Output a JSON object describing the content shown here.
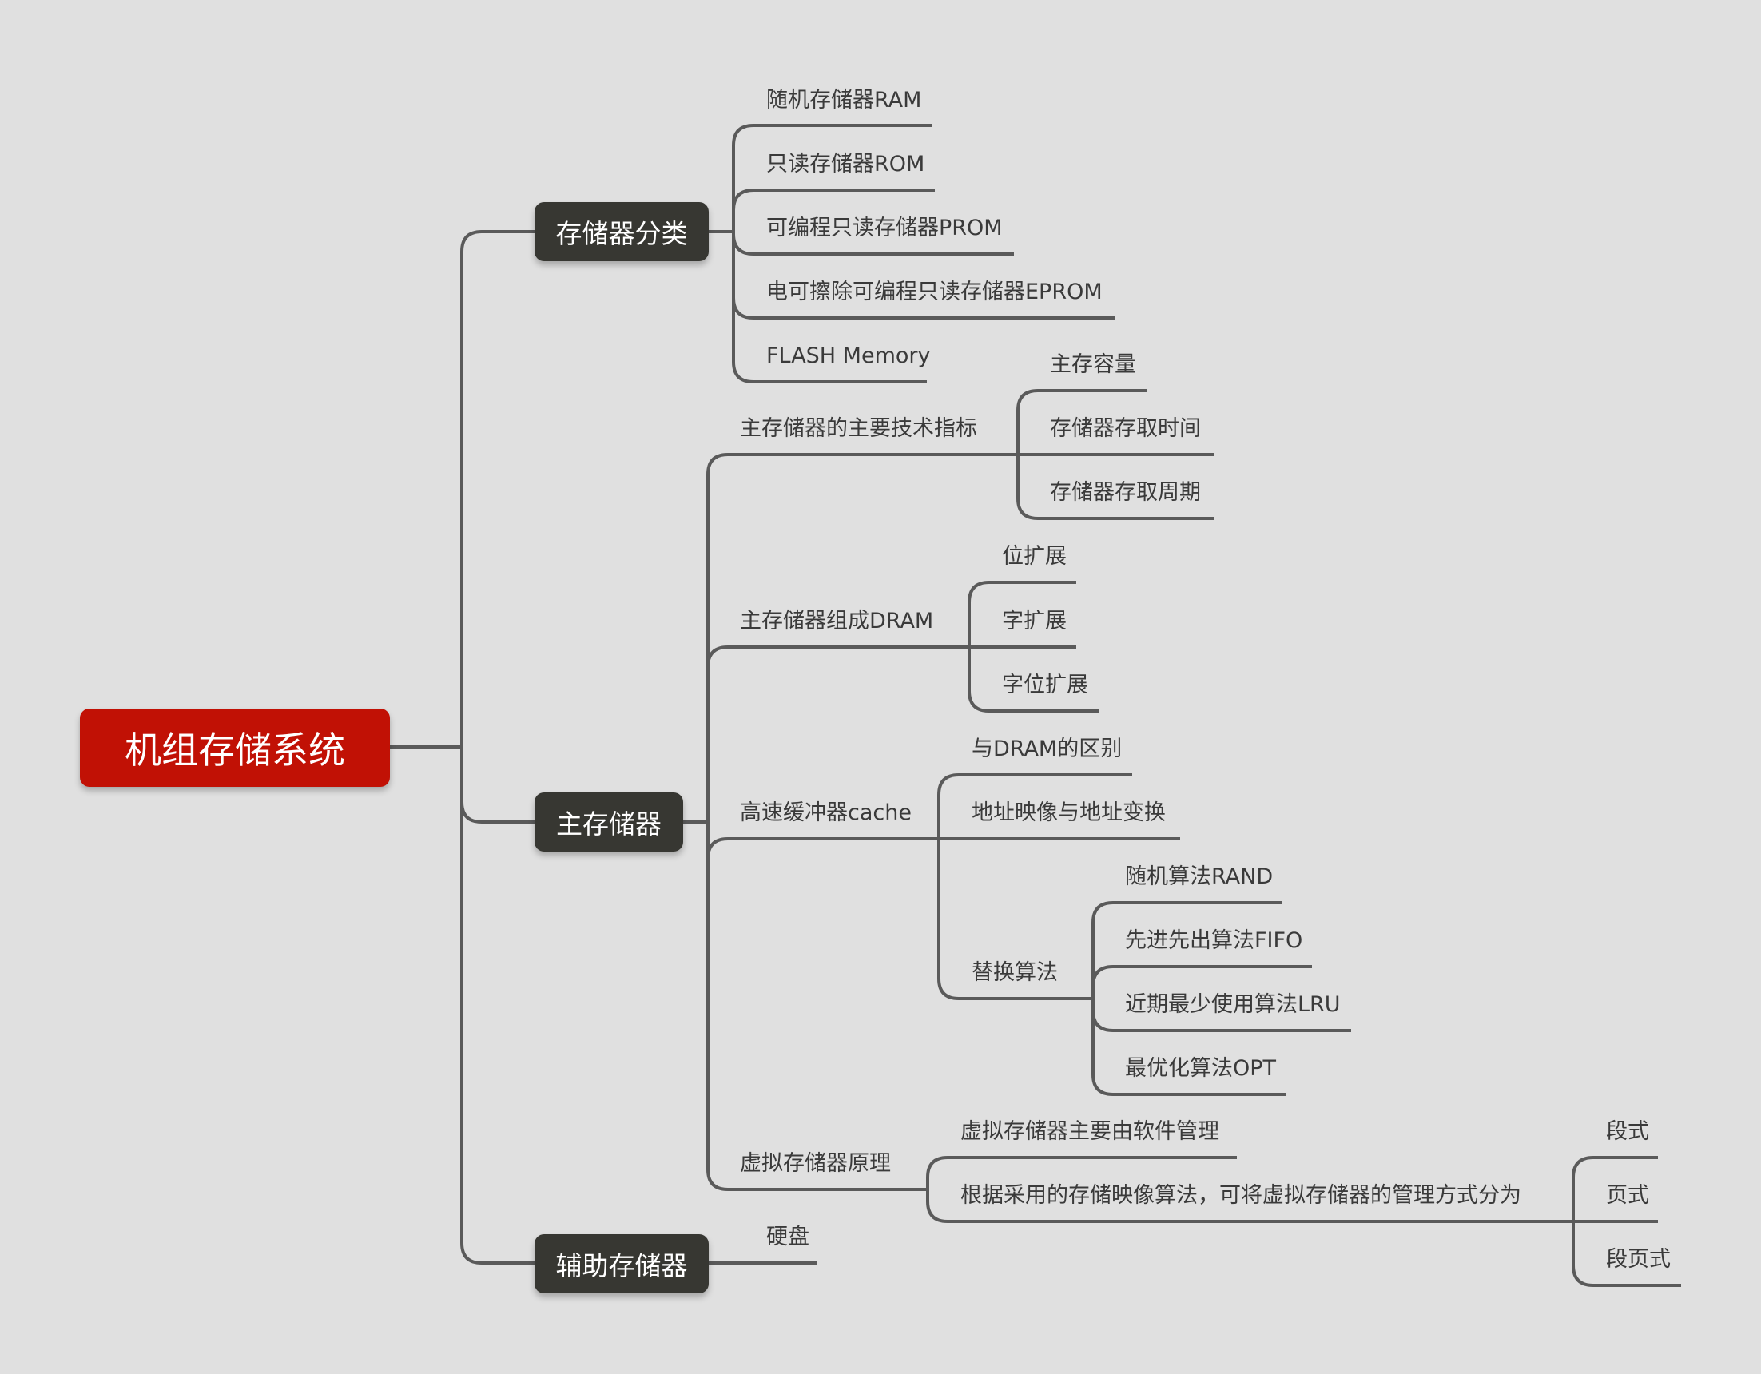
{
  "root": {
    "label": "机组存储系统",
    "color": "#c11105"
  },
  "branches": {
    "classification": {
      "label": "存储器分类",
      "items": [
        "随机存储器RAM",
        "只读存储器ROM",
        "可编程只读存储器PROM",
        "电可擦除可编程只读存储器EPROM",
        "FLASH Memory"
      ]
    },
    "main_memory": {
      "label": "主存储器",
      "tech_specs": {
        "label": "主存储器的主要技术指标",
        "items": [
          "主存容量",
          "存储器存取时间",
          "存储器存取周期"
        ]
      },
      "dram": {
        "label": "主存储器组成DRAM",
        "items": [
          "位扩展",
          "字扩展",
          "字位扩展"
        ]
      },
      "cache": {
        "label": "高速缓冲器cache",
        "items": [
          "与DRAM的区别",
          "地址映像与地址变换"
        ],
        "replacement": {
          "label": "替换算法",
          "items": [
            "随机算法RAND",
            "先进先出算法FIFO",
            "近期最少使用算法LRU",
            "最优化算法OPT"
          ]
        }
      },
      "virtual": {
        "label": "虚拟存储器原理",
        "items": [
          "虚拟存储器主要由软件管理"
        ],
        "management": {
          "label": "根据采用的存储映像算法，可将虚拟存储器的管理方式分为",
          "items": [
            "段式",
            "页式",
            "段页式"
          ]
        }
      }
    },
    "auxiliary": {
      "label": "辅助存储器",
      "items": [
        "硬盘"
      ]
    }
  }
}
